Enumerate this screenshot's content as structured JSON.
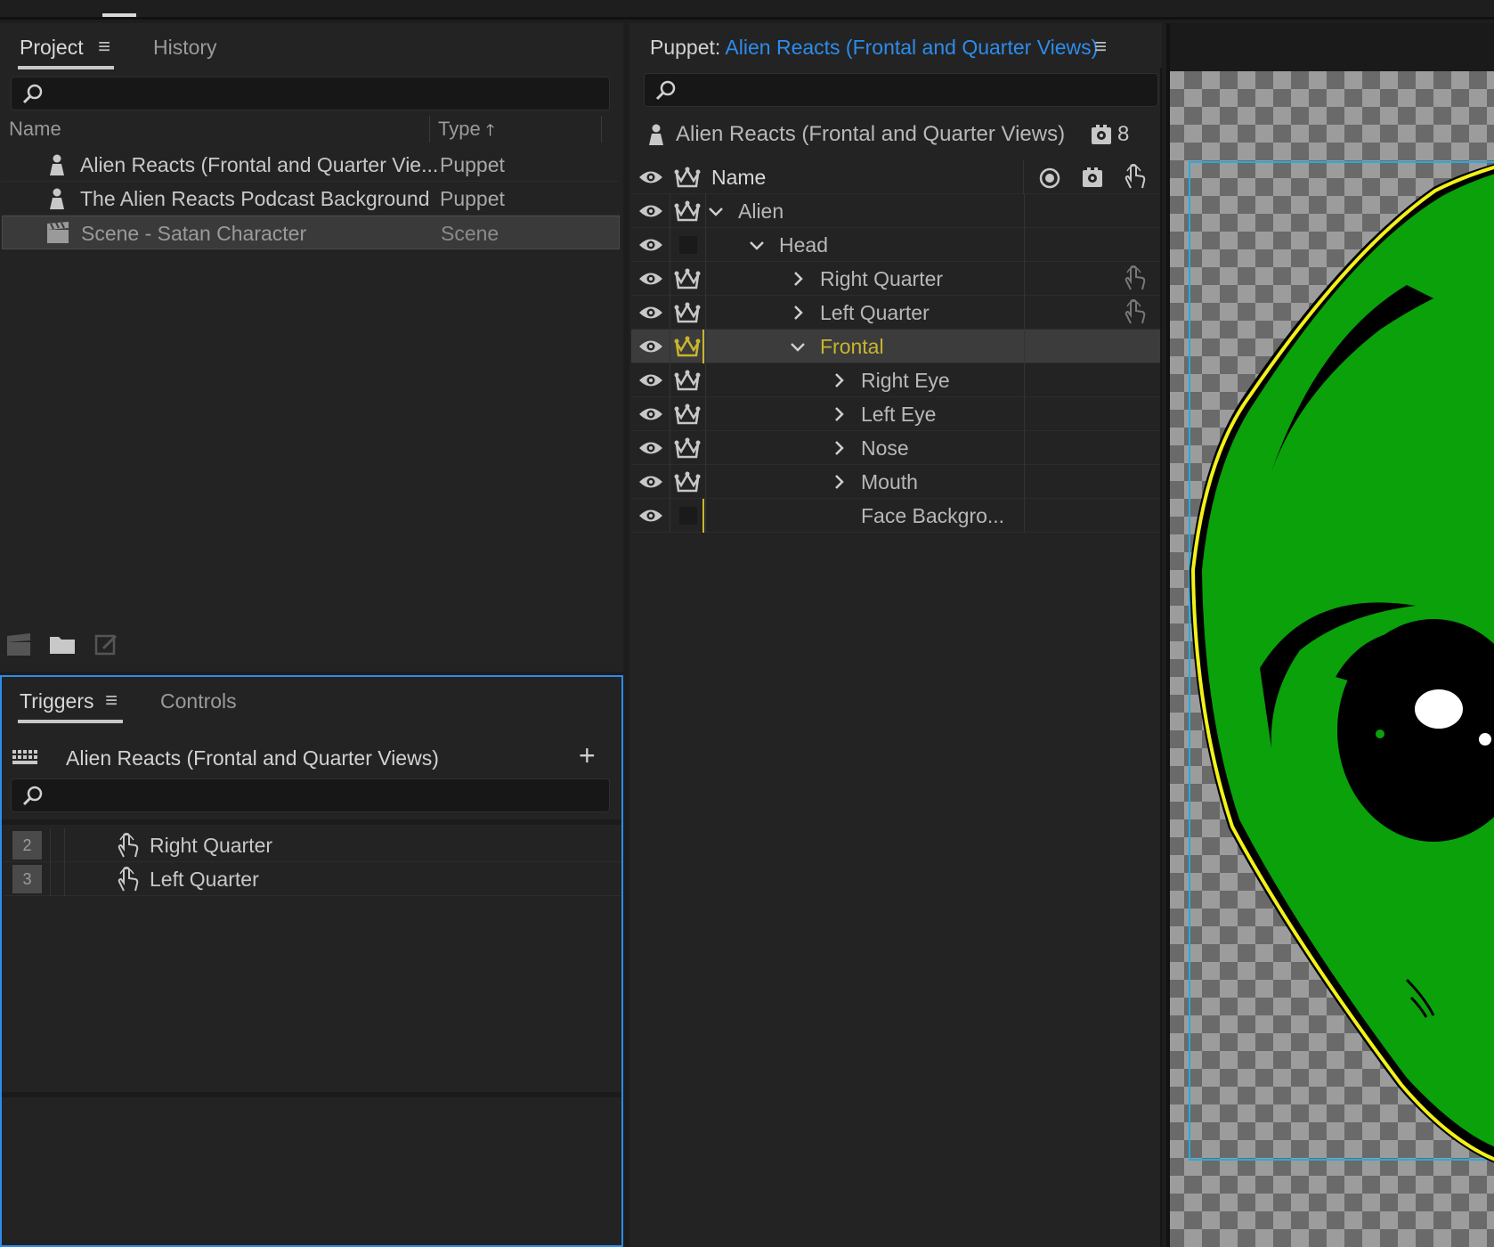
{
  "project": {
    "tabs": [
      {
        "label": "Project"
      },
      {
        "label": "History"
      }
    ],
    "search": {
      "placeholder": "",
      "value": ""
    },
    "columns": {
      "name": "Name",
      "type": "Type"
    },
    "items": [
      {
        "name": "Alien Reacts (Frontal and Quarter Vie...",
        "type": "Puppet",
        "icon": "puppet-icon"
      },
      {
        "name": "The Alien Reacts Podcast Background",
        "type": "Puppet",
        "icon": "puppet-icon"
      },
      {
        "name": "Scene - Satan Character",
        "type": "Scene",
        "icon": "scene-clapper-icon",
        "selected": true
      }
    ],
    "footer_icons": [
      "new-scene-icon",
      "new-folder-icon",
      "edit-icon"
    ]
  },
  "triggers": {
    "tabs": [
      {
        "label": "Triggers"
      },
      {
        "label": "Controls"
      }
    ],
    "puppet_name": "Alien Reacts (Frontal and Quarter Views)",
    "search": {
      "placeholder": "",
      "value": ""
    },
    "items": [
      {
        "key": "2",
        "name": "Right Quarter",
        "icon": "hand-pointer-icon"
      },
      {
        "key": "3",
        "name": "Left Quarter",
        "icon": "hand-pointer-icon"
      }
    ]
  },
  "puppet": {
    "title_prefix": "Puppet:",
    "title_name": "Alien Reacts (Frontal and Quarter Views)",
    "search": {
      "placeholder": "",
      "value": ""
    },
    "header_name": "Alien Reacts (Frontal and Quarter Views)",
    "behaviors_count": "8",
    "column_name": "Name",
    "layers": [
      {
        "name": "Alien",
        "chevron": "down",
        "crown": true,
        "trigger": false
      },
      {
        "name": "Head",
        "chevron": "down",
        "crown": false,
        "trigger": false
      },
      {
        "name": "Right Quarter",
        "chevron": "right",
        "crown": true,
        "trigger": true
      },
      {
        "name": "Left Quarter",
        "chevron": "right",
        "crown": true,
        "trigger": true
      },
      {
        "name": "Frontal",
        "chevron": "down",
        "crown": true,
        "trigger": false,
        "selected": true
      },
      {
        "name": "Right Eye",
        "chevron": "right",
        "crown": true,
        "trigger": false
      },
      {
        "name": "Left Eye",
        "chevron": "right",
        "crown": true,
        "trigger": false
      },
      {
        "name": "Nose",
        "chevron": "right",
        "crown": true,
        "trigger": false
      },
      {
        "name": "Mouth",
        "chevron": "right",
        "crown": true,
        "trigger": false
      },
      {
        "name": "Face Backgro...",
        "chevron": "none",
        "crown": false,
        "trigger": false
      }
    ]
  },
  "colors": {
    "accent_blue": "#2d8ceb",
    "selected_yellow": "#c9b52e",
    "alien_green": "#0aa10a",
    "outline_yellow": "#f2f21a"
  }
}
